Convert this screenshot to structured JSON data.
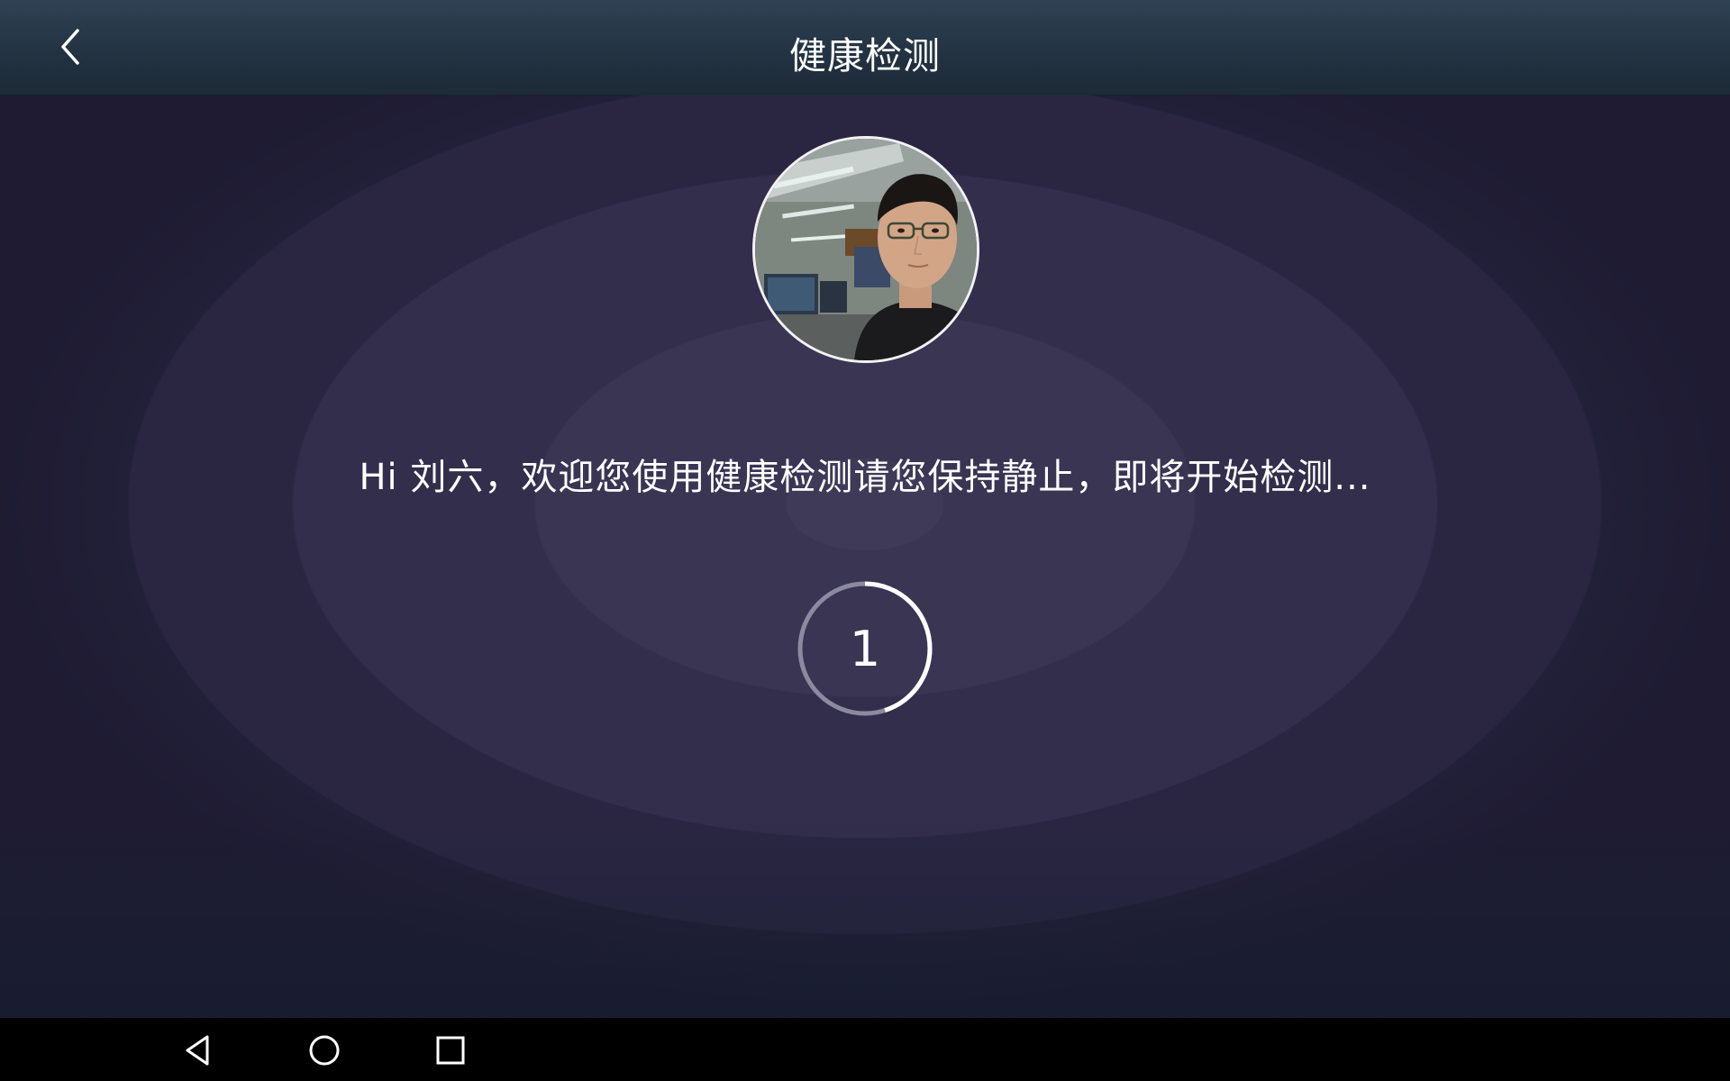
{
  "header": {
    "title": "健康检测",
    "back_icon": "chevron-left-icon"
  },
  "avatar": {
    "description_icon": "user-photo"
  },
  "message": "Hi 刘六，欢迎您使用健康检测请您保持静止，即将开始检测...",
  "countdown": {
    "value": "1",
    "progress": 0.45
  },
  "navbar": {
    "back_icon": "triangle-back-icon",
    "home_icon": "circle-home-icon",
    "recents_icon": "square-recents-icon"
  },
  "colors": {
    "header_top": "#2f4253",
    "header_bottom": "#1d2a38",
    "background_center": "#3f3a58",
    "background_edge": "#1e1b33",
    "ring_track": "#8c8aa0",
    "ring_progress": "#ffffff"
  }
}
